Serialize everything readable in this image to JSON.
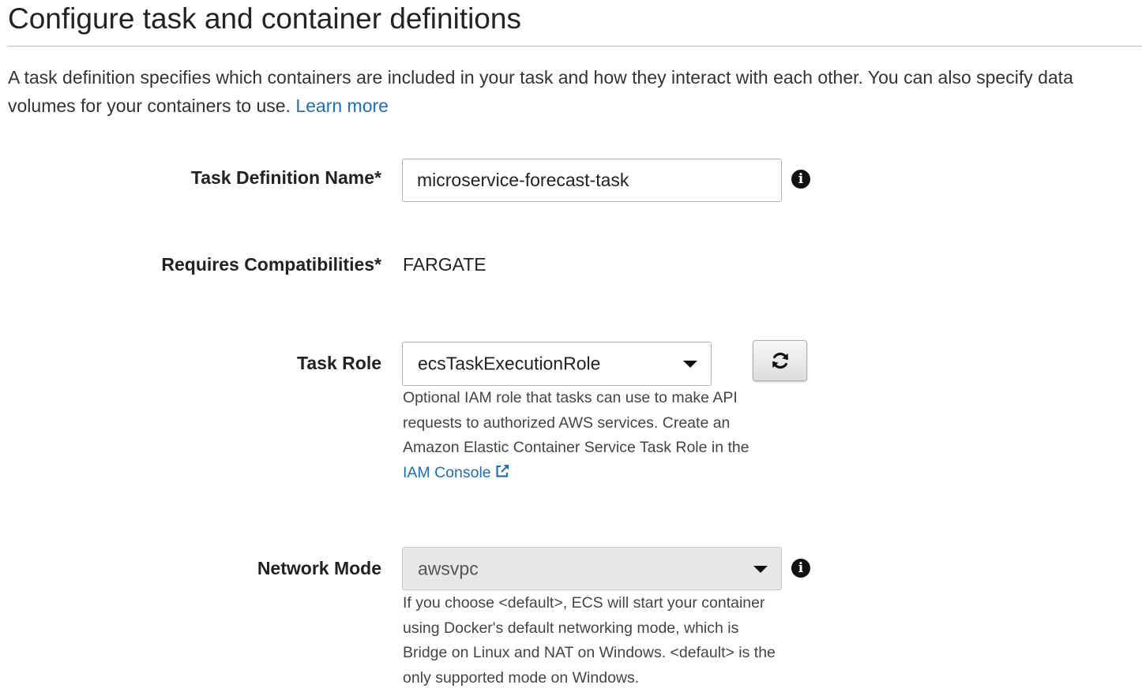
{
  "header": {
    "title": "Configure task and container definitions"
  },
  "intro": {
    "text": "A task definition specifies which containers are included in your task and how they interact with each other. You can also specify data volumes for your containers to use.",
    "learn_more": "Learn more"
  },
  "task_definition_name": {
    "label": "Task Definition Name*",
    "value": "microservice-forecast-task",
    "icon": "info-icon"
  },
  "requires_compatibilities": {
    "label": "Requires Compatibilities*",
    "value": "FARGATE"
  },
  "task_role": {
    "label": "Task Role",
    "selected": "ecsTaskExecutionRole",
    "refresh_icon": "refresh-icon",
    "help_text": "Optional IAM role that tasks can use to make API requests to authorized AWS services. Create an Amazon Elastic Container Service Task Role in the",
    "help_link": "IAM Console",
    "help_link_icon": "external-link-icon"
  },
  "network_mode": {
    "label": "Network Mode",
    "selected": "awsvpc",
    "disabled": true,
    "icon": "info-icon",
    "help_text": "If you choose <default>, ECS will start your container using Docker's default networking mode, which is Bridge on Linux and NAT on Windows. <default> is the only supported mode on Windows."
  },
  "colors": {
    "link": "#1f6fb5",
    "disabled_select_bg": "#e6e8e8",
    "border": "#aab7b8"
  }
}
